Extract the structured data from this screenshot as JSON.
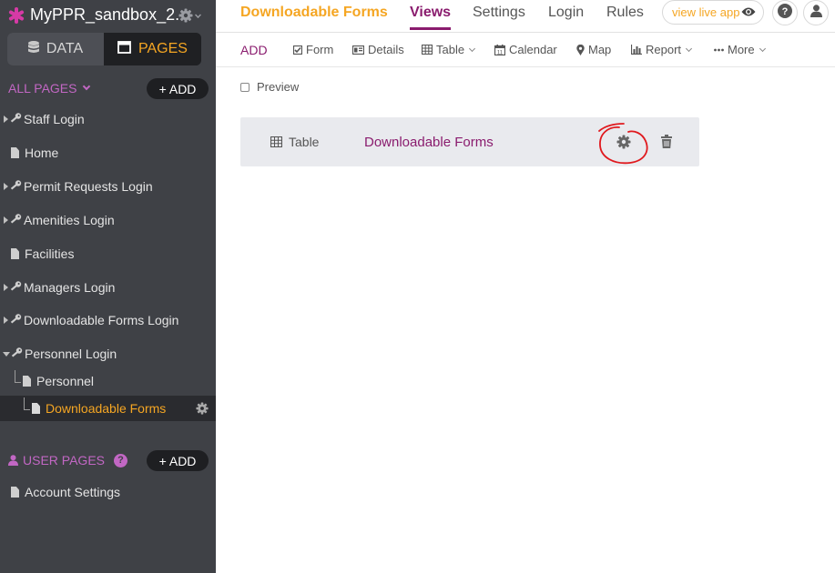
{
  "sidebar": {
    "app_name": "MyPPR_sandbox_2...",
    "data_tab": "DATA",
    "pages_tab": "PAGES",
    "all_pages_label": "ALL PAGES",
    "all_pages_add": "+ ADD",
    "items": [
      {
        "label": "Staff Login"
      },
      {
        "label": "Home"
      },
      {
        "label": "Permit Requests Login"
      },
      {
        "label": "Amenities Login"
      },
      {
        "label": "Facilities"
      },
      {
        "label": "Managers Login"
      },
      {
        "label": "Downloadable Forms Login"
      },
      {
        "label": "Personnel Login"
      },
      {
        "label": "Personnel"
      },
      {
        "label": "Downloadable Forms"
      }
    ],
    "user_pages_label": "USER PAGES",
    "user_pages_help": "?",
    "user_pages_add": "+ ADD",
    "user_items": [
      {
        "label": "Account Settings"
      }
    ]
  },
  "header": {
    "page_title": "Downloadable Forms",
    "tabs": [
      {
        "label": "Views"
      },
      {
        "label": "Settings"
      },
      {
        "label": "Login"
      },
      {
        "label": "Rules"
      }
    ],
    "live_app_label": "view live app"
  },
  "toolbar": {
    "add_label": "ADD",
    "items": [
      {
        "label": "Form"
      },
      {
        "label": "Details"
      },
      {
        "label": "Table"
      },
      {
        "label": "Calendar"
      },
      {
        "label": "Map"
      },
      {
        "label": "Report"
      },
      {
        "label": "More"
      }
    ]
  },
  "content": {
    "preview_label": "Preview",
    "view_card": {
      "type_label": "Table",
      "name": "Downloadable Forms"
    }
  },
  "colors": {
    "sidebar_bg": "#3f4146",
    "accent_orange": "#f5a623",
    "accent_purple": "#8a1c6e",
    "pink": "#c267c4",
    "annotation_red": "#e0191e"
  }
}
